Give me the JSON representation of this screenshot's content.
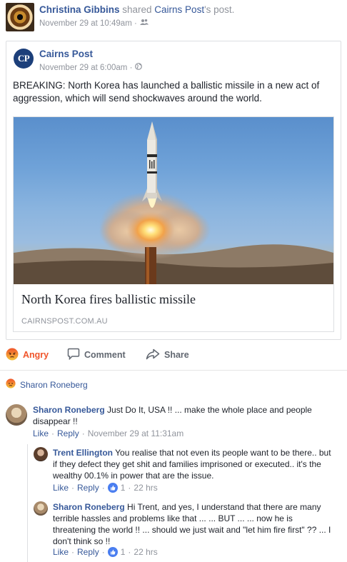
{
  "share": {
    "sharer": "Christina Gibbins",
    "verb": " shared ",
    "page_name": "Cairns Post",
    "suffix": "'s post.",
    "timestamp": "November 29 at 10:49am · "
  },
  "post": {
    "logo_text": "CP",
    "page_name": "Cairns Post",
    "timestamp": "November 29 at 6:00am · ",
    "text": "BREAKING: North Korea has launched a ballistic missile in a new act of aggression, which will send shockwaves around the world.",
    "link": {
      "title": "North Korea fires ballistic missile",
      "domain": "CAIRNSPOST.COM.AU"
    }
  },
  "actions": {
    "reaction_label": "Angry",
    "comment_label": "Comment",
    "share_label": "Share"
  },
  "reactions": {
    "reactor_name": "Sharon Roneberg"
  },
  "comments": [
    {
      "author": "Sharon Roneberg",
      "text": " Just Do It, USA !! ... make the whole place and people disappear !!",
      "like": "Like",
      "reply": "Reply",
      "time": "November 29 at 11:31am"
    },
    {
      "author": "Trent Ellington",
      "text": " You realise that not even its people want to be there.. but if they defect they get shit and families imprisoned or executed.. it's the wealthy 00.1% in power that are the issue.",
      "like": "Like",
      "reply": "Reply",
      "likes": "1",
      "time": "22 hrs"
    },
    {
      "author": "Sharon Roneberg",
      "text": " Hi Trent, and yes, I understand that there are many terrible hassles and problems like that ... ... BUT ... ... now he is threatening the world !! ... should we just wait and \"let him fire first\" ?? ... I don't think so !!",
      "like": "Like",
      "reply": "Reply",
      "likes": "1",
      "time": "22 hrs"
    }
  ],
  "colors": {
    "link_blue": "#365899",
    "muted_gray": "#90949c",
    "angry_orange": "#f0542a",
    "border": "#dddfe2"
  },
  "icons": [
    "friends-icon",
    "globe-icon",
    "angry-icon",
    "comment-icon",
    "share-icon",
    "like-badge-icon"
  ]
}
